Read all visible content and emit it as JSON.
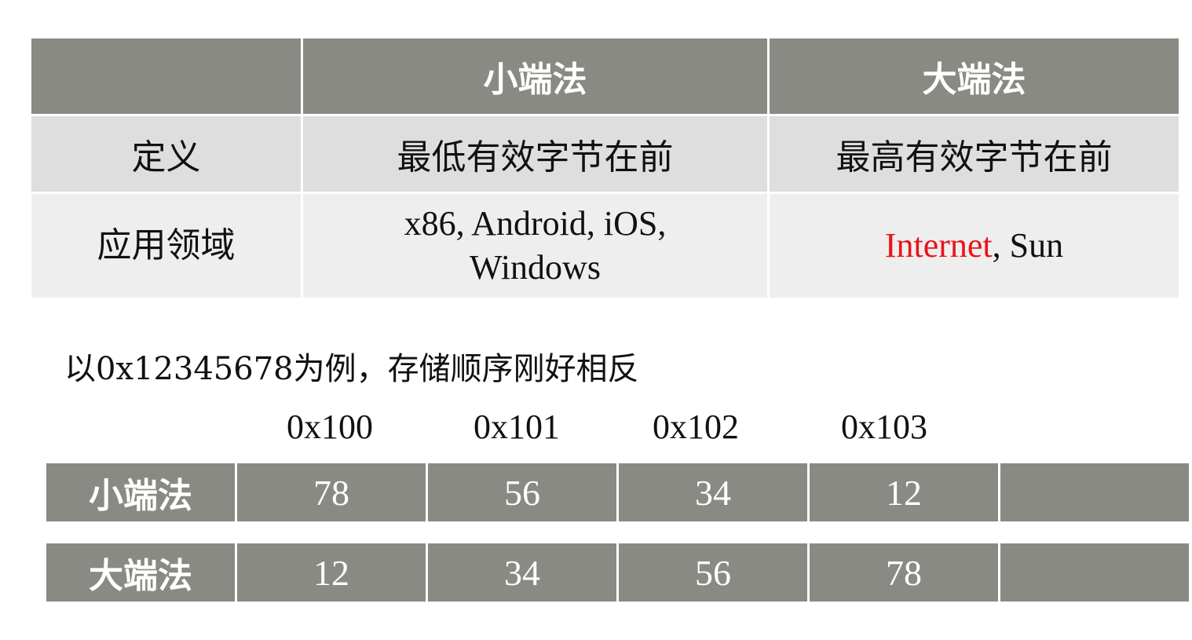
{
  "table": {
    "header": [
      "",
      "小端法",
      "大端法"
    ],
    "rows": [
      {
        "label": "定义",
        "little": "最低有效字节在前",
        "big": "最高有效字节在前"
      },
      {
        "label": "应用领域",
        "little_line1": "x86, Android, iOS,",
        "little_line2": "Windows",
        "big_highlight": "Internet",
        "big_rest": ", Sun"
      }
    ]
  },
  "example": {
    "text": "以0x12345678为例，存储顺序刚好相反",
    "addresses": [
      "0x100",
      "0x101",
      "0x102",
      "0x103"
    ],
    "little": {
      "label": "小端法",
      "bytes": [
        "78",
        "56",
        "34",
        "12",
        ""
      ]
    },
    "big": {
      "label": "大端法",
      "bytes": [
        "12",
        "34",
        "56",
        "78",
        ""
      ]
    }
  },
  "colors": {
    "header_bg": "#8a8a84",
    "row1_bg": "#dedede",
    "row2_bg": "#eeeeee",
    "highlight": "#e8141a"
  }
}
